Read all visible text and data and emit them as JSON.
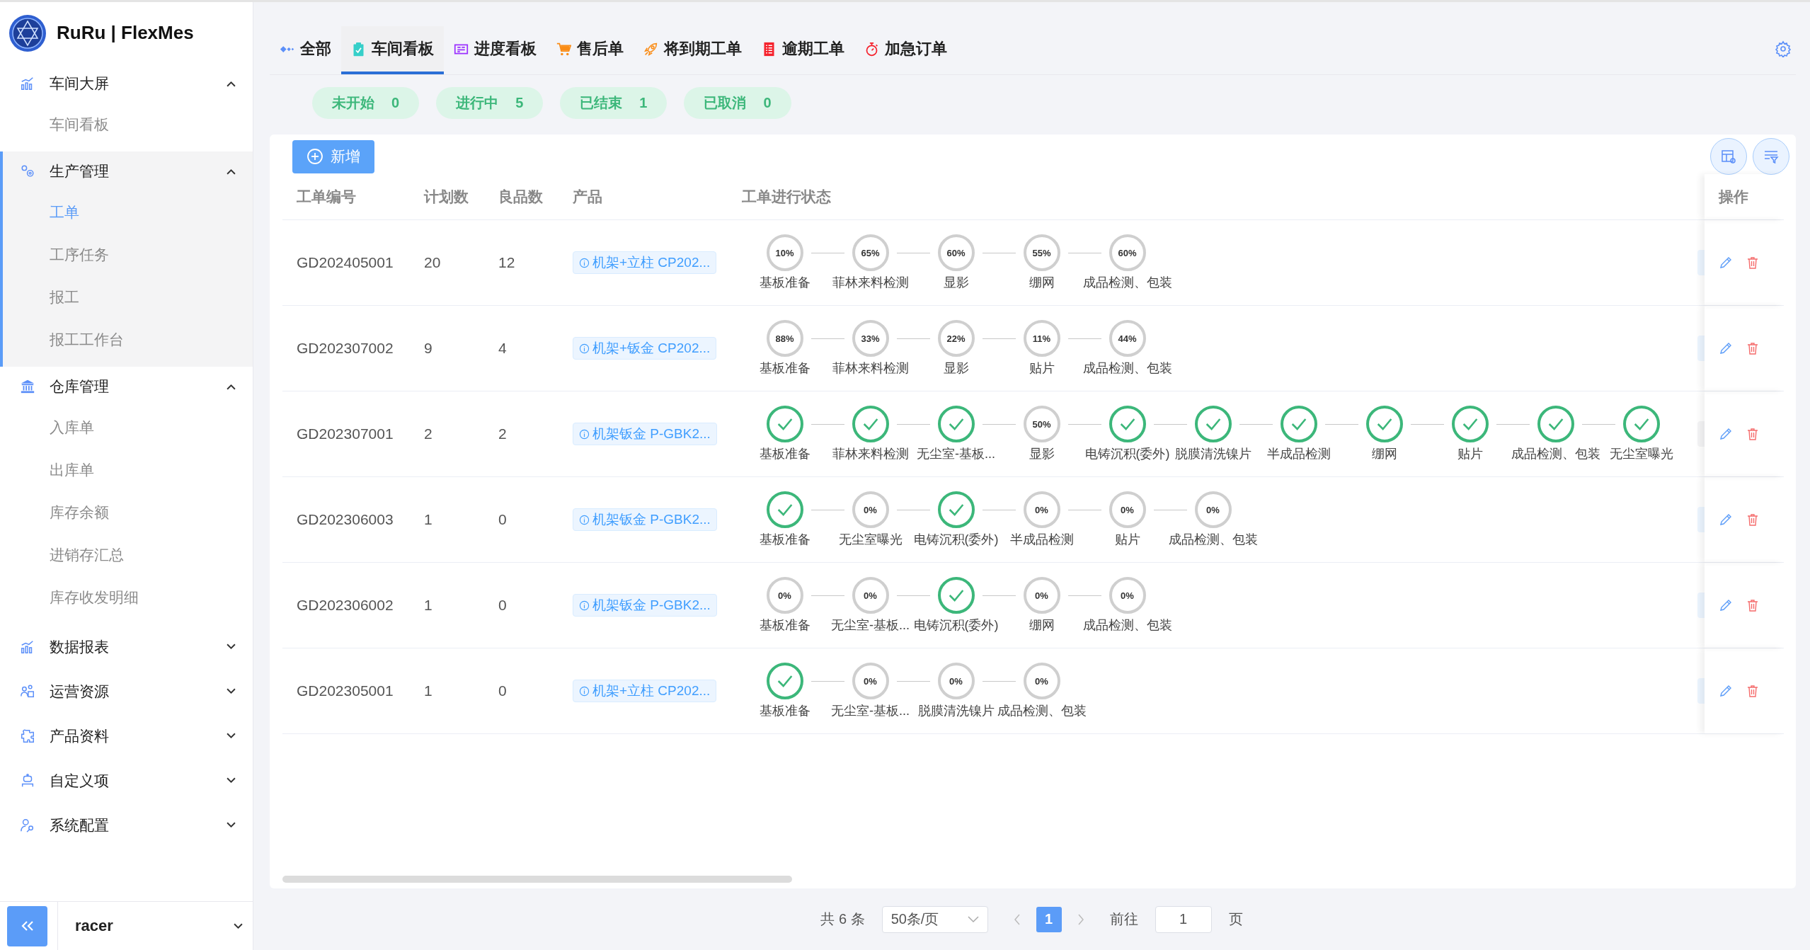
{
  "app": {
    "title": "RuRu | FlexMes"
  },
  "sidebar": {
    "groups": [
      {
        "label": "车间大屏",
        "expanded": true,
        "selected": false,
        "children": [
          {
            "label": "车间看板",
            "selected": false
          }
        ]
      },
      {
        "label": "生产管理",
        "expanded": true,
        "selected": true,
        "children": [
          {
            "label": "工单",
            "selected": true
          },
          {
            "label": "工序任务",
            "selected": false
          },
          {
            "label": "报工",
            "selected": false
          },
          {
            "label": "报工工作台",
            "selected": false
          }
        ]
      },
      {
        "label": "仓库管理",
        "expanded": true,
        "selected": false,
        "children": [
          {
            "label": "入库单",
            "selected": false
          },
          {
            "label": "出库单",
            "selected": false
          },
          {
            "label": "库存余额",
            "selected": false
          },
          {
            "label": "进销存汇总",
            "selected": false
          },
          {
            "label": "库存收发明细",
            "selected": false
          }
        ]
      },
      {
        "label": "数据报表",
        "expanded": false,
        "selected": false
      },
      {
        "label": "运营资源",
        "expanded": false,
        "selected": false
      },
      {
        "label": "产品资料",
        "expanded": false,
        "selected": false
      },
      {
        "label": "自定义项",
        "expanded": false,
        "selected": false
      },
      {
        "label": "系统配置",
        "expanded": false,
        "selected": false
      }
    ],
    "user": {
      "name": "racer"
    }
  },
  "tabs": [
    {
      "label": "全部",
      "selected": false
    },
    {
      "label": "车间看板",
      "selected": true
    },
    {
      "label": "进度看板",
      "selected": false
    },
    {
      "label": "售后单",
      "selected": false
    },
    {
      "label": "将到期工单",
      "selected": false
    },
    {
      "label": "逾期工单",
      "selected": false
    },
    {
      "label": "加急订单",
      "selected": false
    }
  ],
  "status_filters": [
    {
      "label": "未开始",
      "count": "0"
    },
    {
      "label": "进行中",
      "count": "5"
    },
    {
      "label": "已结束",
      "count": "1"
    },
    {
      "label": "已取消",
      "count": "0"
    }
  ],
  "toolbar": {
    "add_button": "新增"
  },
  "table": {
    "columns": [
      "工单编号",
      "计划数",
      "良品数",
      "产品",
      "工单进行状态",
      "操作"
    ],
    "rows": [
      {
        "id": "GD202405001",
        "planned": "20",
        "good": "12",
        "product": "机架+立柱 CP202...",
        "status_tag": {
          "color": "#ecf5ff"
        },
        "steps": [
          {
            "name": "基板准备",
            "kind": "progress",
            "percent": "10%"
          },
          {
            "name": "菲林来料检测",
            "kind": "progress",
            "percent": "65%"
          },
          {
            "name": "显影",
            "kind": "progress",
            "percent": "60%"
          },
          {
            "name": "绷网",
            "kind": "progress",
            "percent": "55%"
          },
          {
            "name": "成品检测、包装",
            "kind": "progress",
            "percent": "60%"
          }
        ]
      },
      {
        "id": "GD202307002",
        "planned": "9",
        "good": "4",
        "product": "机架+钣金 CP202...",
        "status_tag": {
          "color": "#ecf5ff"
        },
        "steps": [
          {
            "name": "基板准备",
            "kind": "progress",
            "percent": "88%"
          },
          {
            "name": "菲林来料检测",
            "kind": "progress",
            "percent": "33%"
          },
          {
            "name": "显影",
            "kind": "progress",
            "percent": "22%"
          },
          {
            "name": "贴片",
            "kind": "progress",
            "percent": "11%"
          },
          {
            "name": "成品检测、包装",
            "kind": "progress",
            "percent": "44%"
          }
        ]
      },
      {
        "id": "GD202307001",
        "planned": "2",
        "good": "2",
        "product": "机架钣金 P-GBK2...",
        "status_tag": {
          "color": "#f4f4f5"
        },
        "steps": [
          {
            "name": "基板准备",
            "kind": "done"
          },
          {
            "name": "菲林来料检测",
            "kind": "done"
          },
          {
            "name": "无尘室-基板...",
            "kind": "done"
          },
          {
            "name": "显影",
            "kind": "progress",
            "percent": "50%"
          },
          {
            "name": "电铸沉积(委外)",
            "kind": "done"
          },
          {
            "name": "脱膜清洗镍片",
            "kind": "done"
          },
          {
            "name": "半成品检测",
            "kind": "done"
          },
          {
            "name": "绷网",
            "kind": "done"
          },
          {
            "name": "贴片",
            "kind": "done"
          },
          {
            "name": "成品检测、包装",
            "kind": "done"
          },
          {
            "name": "无尘室曝光",
            "kind": "done"
          }
        ]
      },
      {
        "id": "GD202306003",
        "planned": "1",
        "good": "0",
        "product": "机架钣金 P-GBK2...",
        "status_tag": {
          "color": "#ecf5ff"
        },
        "steps": [
          {
            "name": "基板准备",
            "kind": "done"
          },
          {
            "name": "无尘室曝光",
            "kind": "progress",
            "percent": "0%"
          },
          {
            "name": "电铸沉积(委外)",
            "kind": "done"
          },
          {
            "name": "半成品检测",
            "kind": "progress",
            "percent": "0%"
          },
          {
            "name": "贴片",
            "kind": "progress",
            "percent": "0%"
          },
          {
            "name": "成品检测、包装",
            "kind": "progress",
            "percent": "0%"
          }
        ]
      },
      {
        "id": "GD202306002",
        "planned": "1",
        "good": "0",
        "product": "机架钣金 P-GBK2...",
        "status_tag": {
          "color": "#ecf5ff"
        },
        "steps": [
          {
            "name": "基板准备",
            "kind": "progress",
            "percent": "0%"
          },
          {
            "name": "无尘室-基板...",
            "kind": "progress",
            "percent": "0%"
          },
          {
            "name": "电铸沉积(委外)",
            "kind": "done"
          },
          {
            "name": "绷网",
            "kind": "progress",
            "percent": "0%"
          },
          {
            "name": "成品检测、包装",
            "kind": "progress",
            "percent": "0%"
          }
        ]
      },
      {
        "id": "GD202305001",
        "planned": "1",
        "good": "0",
        "product": "机架+立柱 CP202...",
        "status_tag": {
          "color": "#ecf5ff"
        },
        "steps": [
          {
            "name": "基板准备",
            "kind": "done"
          },
          {
            "name": "无尘室-基板...",
            "kind": "progress",
            "percent": "0%"
          },
          {
            "name": "脱膜清洗镍片",
            "kind": "progress",
            "percent": "0%"
          },
          {
            "name": "成品检测、包装",
            "kind": "progress",
            "percent": "0%"
          }
        ]
      }
    ]
  },
  "pagination": {
    "total": "共 6 条",
    "page_size": "50条/页",
    "pages": [
      {
        "label": "1",
        "selected": true
      }
    ],
    "goto_label": "前往",
    "goto_value": "1",
    "goto_suffix": "页"
  }
}
